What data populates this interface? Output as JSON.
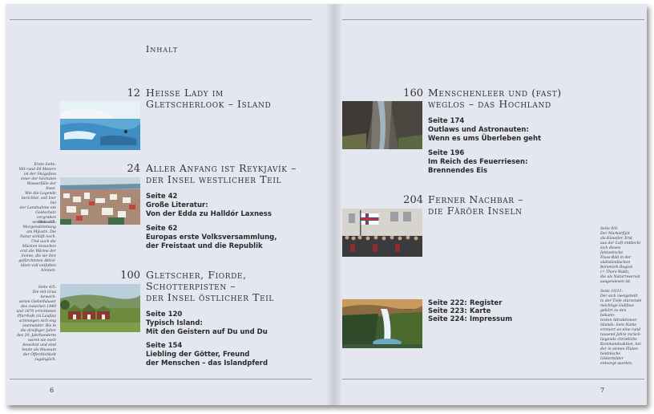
{
  "toc": {
    "title": "Inhalt"
  },
  "chapters": [
    {
      "number": "12",
      "title_lines": [
        "Heisse Lady im",
        "Gletscherlook – Island"
      ],
      "entries": []
    },
    {
      "number": "24",
      "title_lines": [
        "Aller Anfang ist Reykjavík –",
        "der Insel westlicher Teil"
      ],
      "entries": [
        {
          "lines": [
            "Seite 42",
            "Große Literatur:",
            "Von der Edda zu Halldór Laxness"
          ]
        },
        {
          "lines": [
            "Seite 62",
            "Europas erste Volksversammlung,",
            "der Freistaat und die Republik"
          ]
        }
      ]
    },
    {
      "number": "100",
      "title_lines": [
        "Gletscher, Fiorde,",
        "Schotterpisten –",
        "der Insel östlicher Teil"
      ],
      "entries": [
        {
          "lines": [
            "Seite 120",
            "Typisch Island:",
            "Mit den Geistern auf Du und Du"
          ]
        },
        {
          "lines": [
            "Seite 154",
            "Liebling der Götter, Freund",
            "der Menschen – das Islandpferd"
          ]
        }
      ]
    },
    {
      "number": "160",
      "title_lines": [
        "Menschenleer und (fast)",
        "weglos – das Hochland"
      ],
      "entries": [
        {
          "lines": [
            "Seite 174",
            "Outlaws und Astronauten:",
            "Wenn es ums Überleben geht"
          ]
        },
        {
          "lines": [
            "Seite 196",
            "Im Reich des Feuerriesen:",
            "Brennendes Eis"
          ]
        }
      ]
    },
    {
      "number": "204",
      "title_lines": [
        "Ferner Nachbar –",
        "die Färöer Inseln"
      ],
      "entries": []
    }
  ],
  "index_links": [
    {
      "page": "Seite 222:",
      "label": "Register"
    },
    {
      "page": "Seite 223:",
      "label": "Karte"
    },
    {
      "page": "Seite 224:",
      "label": "Impressum"
    }
  ],
  "captions_left": [
    {
      "lines": [
        "Erste Seite:",
        "Mit rund 60 Metern",
        "ist der Skógafoss",
        "einer der höchsten",
        "Wasserfälle der Insel.",
        "Wie die Legende",
        "berichtet, soll hier bei",
        "der Landnahme ein",
        "Goldschatz vergraben",
        "worden sein."
      ]
    },
    {
      "lines": [
        "Seite 2/3:",
        "Morgenstimmung",
        "am Mývatn. Die",
        "Natur schläft noch.",
        "Und auch die",
        "Mücken brauchen",
        "erst die Wärme der",
        "Sonne, die sie ihre",
        "gefürchteten Aktivi-",
        "täten voll entfalten",
        "können."
      ]
    },
    {
      "lines": [
        "Seite 4/5:",
        "Die mit Gras bewach-",
        "senen Giebelhäuser",
        "des zwischen 1840",
        "und 1870 errichteten",
        "Pfarrhofs (in Laufás)",
        "schmiegen sich eng",
        "aneinander. Bis in",
        "die dreißiger Jahre",
        "des 20. Jahrhunderts",
        "waren sie noch",
        "bewohnt und sind",
        "heute als Museum",
        "der Öffentlichkeit",
        "zugänglich."
      ]
    }
  ],
  "captions_right": [
    {
      "lines": [
        "Seite 8/9:",
        "Der Markarfljót",
        "als Künstler. Erst",
        "aus der Luft entdeckt",
        "sich dieses fantastische",
        "Fluss-Bild in der",
        "südisländischen",
        "Þórsmörk-Region",
        "(= Thors Wald),",
        "die als Naturreservat",
        "ausgewiesen ist."
      ]
    },
    {
      "lines": [
        "Seite 10/11:",
        "Der sich zweigeteilt",
        "in der Tiefe stürzende",
        "mächtige Gullfoss",
        "gehört zu den bekann-",
        "testen Attraktionen",
        "Islands. Sein Name",
        "erinnert an eine rund",
        "tausend Jahre zurück-",
        "liegende christliche",
        "Kommandoaktion, bei",
        "der in seinen Fluten",
        "heidnische Götterbilder",
        "entsorgt wurden."
      ]
    }
  ],
  "photos": [
    {
      "subject": "blue-lagoon-photo"
    },
    {
      "subject": "reykjavik-city-photo"
    },
    {
      "subject": "turf-houses-photo"
    },
    {
      "subject": "highland-canyon-photo"
    },
    {
      "subject": "faroe-flag-crowd-photo"
    },
    {
      "subject": "waterfall-photo"
    }
  ],
  "folios": {
    "left": "6",
    "right": "7"
  }
}
